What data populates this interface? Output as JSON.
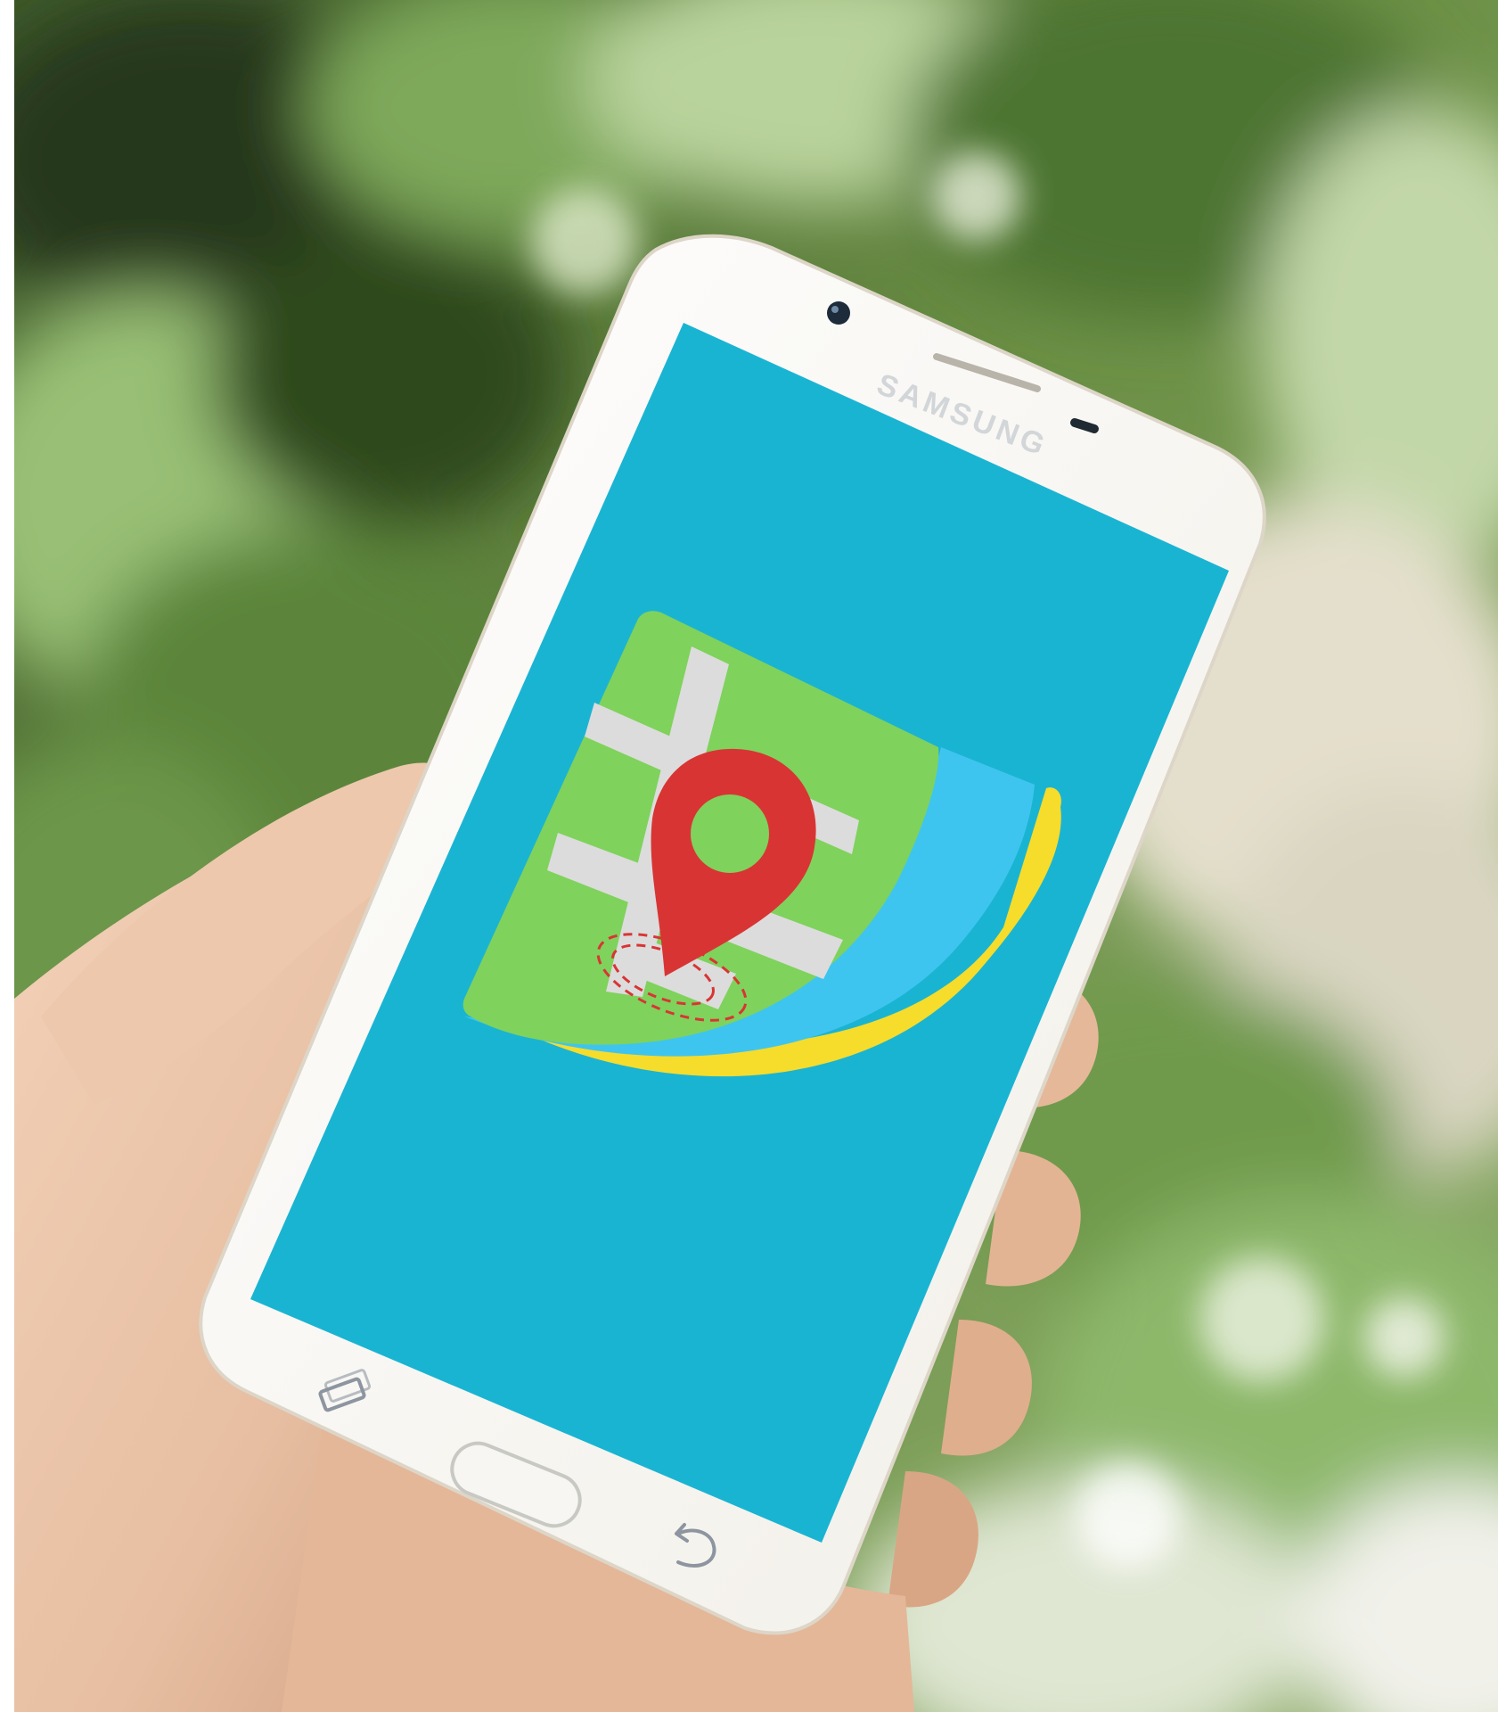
{
  "scene": {
    "description_colors": {
      "page_background": "#ffffff",
      "foliage_dark": "#2f4a1f",
      "foliage_mid": "#5d8a3a",
      "foliage_light": "#a9c98a",
      "wall_beige": "#e6e0cf",
      "skin": "#e9c2a6",
      "skin_shadow": "#c99a7e",
      "phone_body": "#fbfbf8",
      "phone_edge": "#e3ddd0",
      "screen": "#1ab4d3"
    }
  },
  "phone": {
    "brand_label": "SAMSUNG",
    "buttons": [
      "recent-apps",
      "home",
      "back"
    ]
  },
  "app_icon": {
    "colors": {
      "map_green": "#7fd25c",
      "road_gray": "#dcdcdc",
      "pin_red": "#d93434",
      "wave_blue": "#3ec5ef",
      "wave_yellow": "#f6dc2b"
    }
  }
}
